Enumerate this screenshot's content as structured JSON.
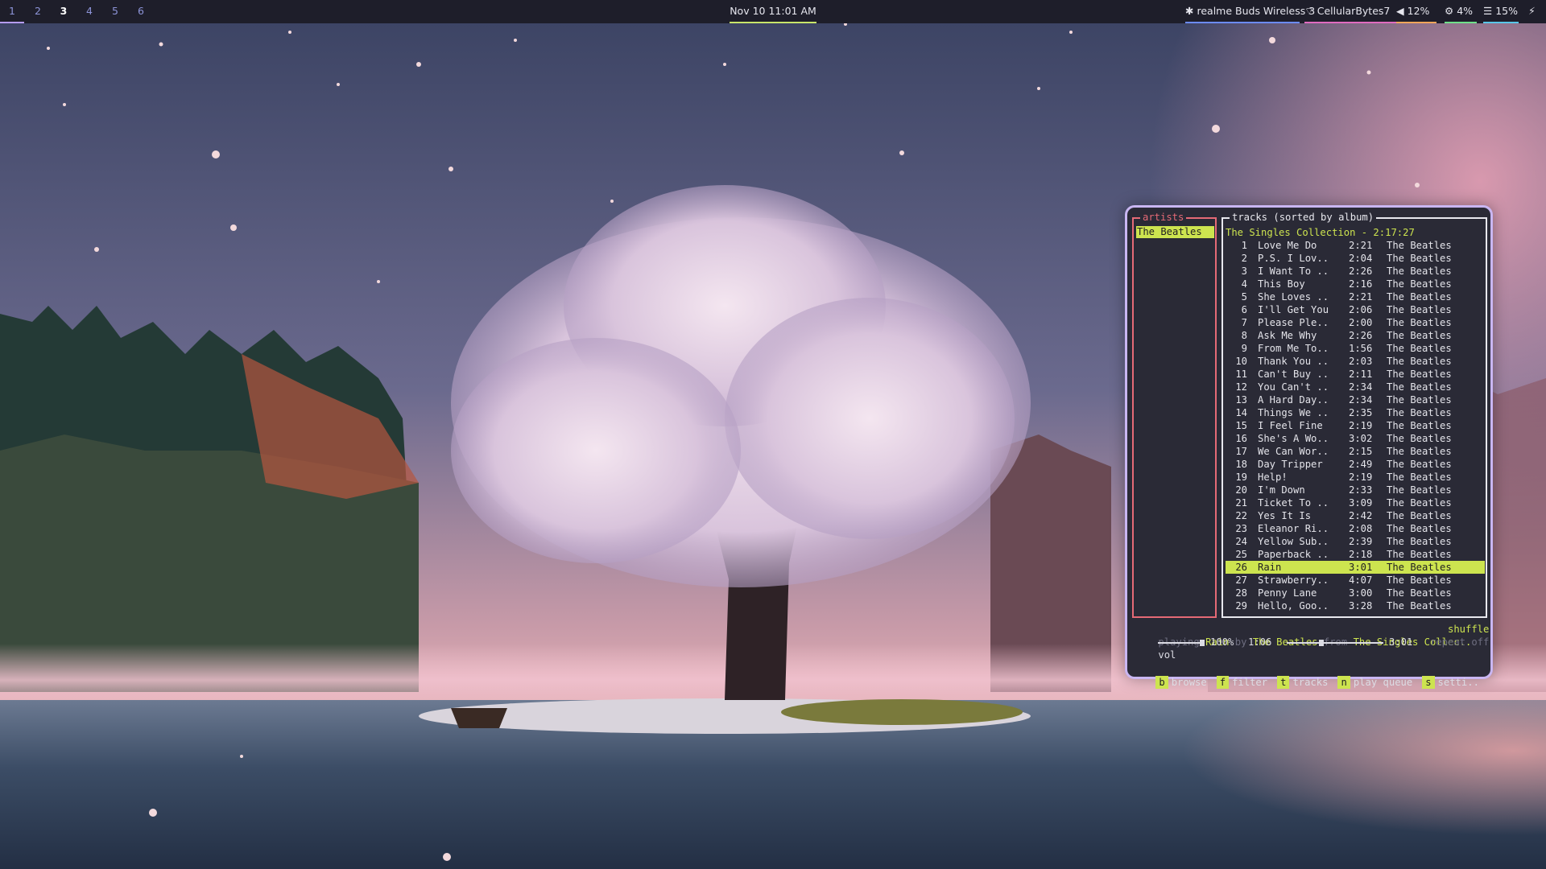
{
  "topbar": {
    "workspaces": [
      "1",
      "2",
      "3",
      "4",
      "5",
      "6"
    ],
    "clock": "Nov 10  11:01 AM",
    "bluetooth": "realme Buds Wireless 3",
    "wifi": "CellularBytes7",
    "volume": "12%",
    "cpu": "4%",
    "memory": "15%",
    "colors": {
      "bluetooth": "#6c8cff",
      "wifi": "#e06cc0",
      "volume": "#f2a65a",
      "cpu": "#6fe08a",
      "memory": "#58c6e8",
      "clock": "#c8e66a",
      "workspace": "#b59cf5"
    }
  },
  "player": {
    "artists_title": "artists",
    "artists": [
      "The Beatles"
    ],
    "tracks_title": "tracks (sorted by album)",
    "album_header": "The Singles Collection - 2:17:27",
    "tracks": [
      {
        "n": "1",
        "title": "Love Me Do",
        "dur": "2:21",
        "artist": "The Beatles"
      },
      {
        "n": "2",
        "title": "P.S. I Lov..",
        "dur": "2:04",
        "artist": "The Beatles"
      },
      {
        "n": "3",
        "title": "I Want To ..",
        "dur": "2:26",
        "artist": "The Beatles"
      },
      {
        "n": "4",
        "title": "This Boy",
        "dur": "2:16",
        "artist": "The Beatles"
      },
      {
        "n": "5",
        "title": "She Loves ..",
        "dur": "2:21",
        "artist": "The Beatles"
      },
      {
        "n": "6",
        "title": "I'll Get You",
        "dur": "2:06",
        "artist": "The Beatles"
      },
      {
        "n": "7",
        "title": "Please Ple..",
        "dur": "2:00",
        "artist": "The Beatles"
      },
      {
        "n": "8",
        "title": "Ask Me Why",
        "dur": "2:26",
        "artist": "The Beatles"
      },
      {
        "n": "9",
        "title": "From Me To..",
        "dur": "1:56",
        "artist": "The Beatles"
      },
      {
        "n": "10",
        "title": "Thank You ..",
        "dur": "2:03",
        "artist": "The Beatles"
      },
      {
        "n": "11",
        "title": "Can't Buy ..",
        "dur": "2:11",
        "artist": "The Beatles"
      },
      {
        "n": "12",
        "title": "You Can't ..",
        "dur": "2:34",
        "artist": "The Beatles"
      },
      {
        "n": "13",
        "title": "A Hard Day..",
        "dur": "2:34",
        "artist": "The Beatles"
      },
      {
        "n": "14",
        "title": "Things We ..",
        "dur": "2:35",
        "artist": "The Beatles"
      },
      {
        "n": "15",
        "title": "I Feel Fine",
        "dur": "2:19",
        "artist": "The Beatles"
      },
      {
        "n": "16",
        "title": "She's A Wo..",
        "dur": "3:02",
        "artist": "The Beatles"
      },
      {
        "n": "17",
        "title": "We Can Wor..",
        "dur": "2:15",
        "artist": "The Beatles"
      },
      {
        "n": "18",
        "title": "Day Tripper",
        "dur": "2:49",
        "artist": "The Beatles"
      },
      {
        "n": "19",
        "title": "Help!",
        "dur": "2:19",
        "artist": "The Beatles"
      },
      {
        "n": "20",
        "title": "I'm Down",
        "dur": "2:33",
        "artist": "The Beatles"
      },
      {
        "n": "21",
        "title": "Ticket To ..",
        "dur": "3:09",
        "artist": "The Beatles"
      },
      {
        "n": "22",
        "title": "Yes It Is",
        "dur": "2:42",
        "artist": "The Beatles"
      },
      {
        "n": "23",
        "title": "Eleanor Ri..",
        "dur": "2:08",
        "artist": "The Beatles"
      },
      {
        "n": "24",
        "title": "Yellow Sub..",
        "dur": "2:39",
        "artist": "The Beatles"
      },
      {
        "n": "25",
        "title": "Paperback ..",
        "dur": "2:18",
        "artist": "The Beatles"
      },
      {
        "n": "26",
        "title": "Rain",
        "dur": "3:01",
        "artist": "The Beatles"
      },
      {
        "n": "27",
        "title": "Strawberry..",
        "dur": "4:07",
        "artist": "The Beatles"
      },
      {
        "n": "28",
        "title": "Penny Lane",
        "dur": "3:00",
        "artist": "The Beatles"
      },
      {
        "n": "29",
        "title": "Hello, Goo..",
        "dur": "3:28",
        "artist": "The Beatles"
      }
    ],
    "selected_track": "26",
    "status": {
      "playing_word": "playing",
      "song": "Rain",
      "by_word": "by",
      "artist": "The Beatles",
      "from_word": "from",
      "album": "The Singles Collec..",
      "shuffle": "shuffle",
      "vol_label": "vol",
      "volume": "100%",
      "volume_fraction": 1.0,
      "elapsed": "1:06",
      "total": "3:01",
      "progress_fraction": 0.36,
      "repeat": "repeat off"
    },
    "keys": [
      {
        "key": "b",
        "label": "browse"
      },
      {
        "key": "f",
        "label": "filter"
      },
      {
        "key": "t",
        "label": "tracks"
      },
      {
        "key": "n",
        "label": "play queue"
      },
      {
        "key": "s",
        "label": "setti.."
      }
    ]
  }
}
